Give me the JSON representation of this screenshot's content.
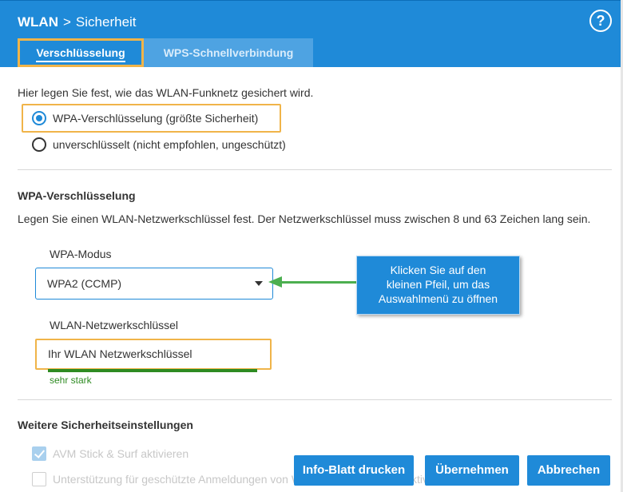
{
  "header": {
    "crumb_root": "WLAN",
    "crumb_separator": ">",
    "crumb_leaf": "Sicherheit",
    "help_symbol": "?"
  },
  "tabs": [
    {
      "label": "Verschlüsselung",
      "active": true
    },
    {
      "label": "WPS-Schnellverbindung",
      "active": false
    }
  ],
  "encryption": {
    "intro": "Hier legen Sie fest, wie das WLAN-Funknetz gesichert wird.",
    "options": [
      {
        "label": "WPA-Verschlüsselung (größte Sicherheit)",
        "checked": true
      },
      {
        "label": "unverschlüsselt (nicht empfohlen, ungeschützt)",
        "checked": false
      }
    ]
  },
  "wpa": {
    "title": "WPA-Verschlüsselung",
    "description": "Legen Sie einen WLAN-Netzwerkschlüssel fest. Der Netzwerkschlüssel muss zwischen 8 und 63 Zeichen lang sein.",
    "mode_label": "WPA-Modus",
    "mode_value": "WPA2 (CCMP)",
    "key_label": "WLAN-Netzwerkschlüssel",
    "key_value": "Ihr WLAN Netzwerkschlüssel",
    "strength": "sehr stark"
  },
  "callout": {
    "line1": "Klicken Sie auf den",
    "line2": "kleinen Pfeil, um das",
    "line3": "Auswahlmenü zu öffnen"
  },
  "further": {
    "title": "Weitere Sicherheitseinstellungen",
    "items": [
      {
        "label": "AVM Stick & Surf aktivieren",
        "checked": true
      },
      {
        "label": "Unterstützung für geschützte Anmeldungen von WLAN-Geräten (PMF) aktivieren",
        "checked": false
      }
    ]
  },
  "buttons": {
    "info": "Info-Blatt drucken",
    "apply": "Übernehmen",
    "cancel": "Abbrechen"
  },
  "colors": {
    "accent": "#1f8ad8",
    "highlight": "#f0b449",
    "arrow": "#4caf50",
    "strength": "#2e8b22"
  }
}
